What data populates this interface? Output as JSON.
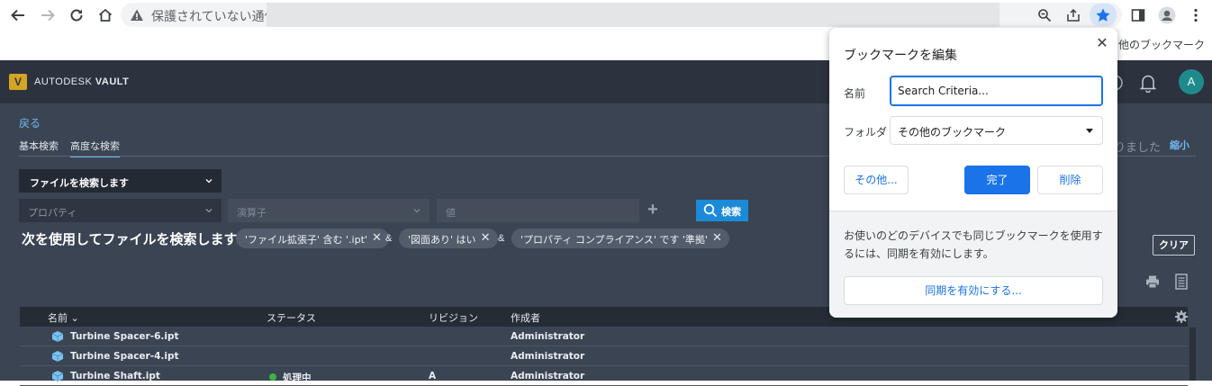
{
  "browser": {
    "security_text": "保護されていない通信",
    "bookmarks_bar": {
      "other_bookmarks": "その他のブックマーク"
    }
  },
  "bookmark_dialog": {
    "title": "ブックマークを編集",
    "name_label": "名前",
    "name_value": "Search Criteria...",
    "folder_label": "フォルダ",
    "folder_value": "その他のブックマーク",
    "more_button": "その他...",
    "done_button": "完了",
    "delete_button": "削除",
    "sync_text": "お使いのどのデバイスでも同じブックマークを使用するには、同期を有効にします。",
    "sync_button": "同期を有効にする..."
  },
  "app": {
    "logo_letter": "V",
    "logo_brand": "AUTODESK",
    "logo_product": "VAULT",
    "avatar_initial": "A",
    "back_link": "戻る",
    "tabs": [
      {
        "label": "基本検索"
      },
      {
        "label": "高度な検索"
      }
    ],
    "notice_fragment": "りました",
    "collapse_link": "縮小",
    "search_type": "ファイルを検索します",
    "property_placeholder": "プロパティ",
    "operator_placeholder": "演算子",
    "value_placeholder": "値",
    "plus": "+",
    "search_button": "検索",
    "criteria_title": "次を使用してファイルを検索します",
    "criteria": [
      {
        "label": "'ファイル拡張子' 含む '.ipt'"
      },
      {
        "label": "'図面あり' はい"
      },
      {
        "label": "'プロパティ コンプライアンス' です '準拠'"
      }
    ],
    "amp": "&",
    "clear_button": "クリア",
    "grid": {
      "headers": {
        "name": "名前",
        "status": "ステータス",
        "revision": "リビジョン",
        "author": "作成者"
      },
      "rows": [
        {
          "name": "Turbine Spacer-6.ipt",
          "status": "",
          "revision": "",
          "author": "Administrator"
        },
        {
          "name": "Turbine Spacer-4.ipt",
          "status": "",
          "revision": "",
          "author": "Administrator"
        },
        {
          "name": "Turbine Shaft.ipt",
          "status": "処理中",
          "revision": "A",
          "author": "Administrator"
        }
      ]
    }
  },
  "colors": {
    "accent_blue": "#1a73e8",
    "vault_header": "#2c333f",
    "vault_body": "#3b4453",
    "vault_link": "#6fb7ee",
    "status_green": "#41b13f",
    "logo_gold": "#d5a422"
  },
  "icons": [
    "back-icon",
    "forward-icon",
    "reload-icon",
    "home-icon",
    "warning-icon",
    "zoom-icon",
    "share-icon",
    "star-icon",
    "sidepanel-icon",
    "profile-icon",
    "menu-icon",
    "close-icon",
    "search-icon",
    "help-icon",
    "bell-icon",
    "print-icon",
    "document-icon",
    "gear-icon",
    "part-icon",
    "chevron-down-icon"
  ]
}
